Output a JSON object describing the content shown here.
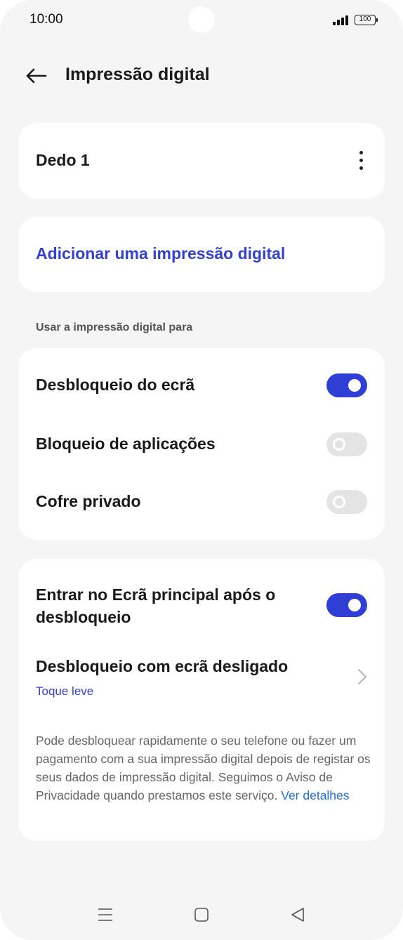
{
  "status_bar": {
    "time": "10:00",
    "battery": "100"
  },
  "header": {
    "title": "Impressão digital"
  },
  "fingerprints": [
    {
      "label": "Dedo 1"
    }
  ],
  "add_fingerprint": "Adicionar uma impressão digital",
  "use_section": {
    "header": "Usar a impressão digital para",
    "items": [
      {
        "label": "Desbloqueio do ecrã",
        "enabled": true
      },
      {
        "label": "Bloqueio de aplicações",
        "enabled": false
      },
      {
        "label": "Cofre privado",
        "enabled": false
      }
    ]
  },
  "more_section": {
    "home_after_unlock": {
      "label_line1": "Entrar no Ecrã principal após o",
      "label_line2": "desbloqueio",
      "enabled": true
    },
    "screen_off_unlock": {
      "label": "Desbloqueio com ecrã desligado",
      "value": "Toque leve"
    },
    "description": "Pode desbloquear rapidamente o seu telefone ou fazer um pagamento com a sua impressão digital depois de registar os seus dados de impressão digital. Seguimos o Aviso de Privacidade quando prestamos este serviço.",
    "details_link": "Ver detalhes"
  },
  "colors": {
    "accent": "#2f3fd6",
    "link": "#3341d3",
    "details_link": "#1f6fd8",
    "background": "#f5f5f5",
    "card": "#ffffff"
  },
  "icons": {
    "back": "arrow-left-icon",
    "more": "more-vertical-icon",
    "chevron": "chevron-right-icon",
    "nav_menu": "menu-icon",
    "nav_home": "home-square-icon",
    "nav_back": "back-triangle-icon"
  }
}
